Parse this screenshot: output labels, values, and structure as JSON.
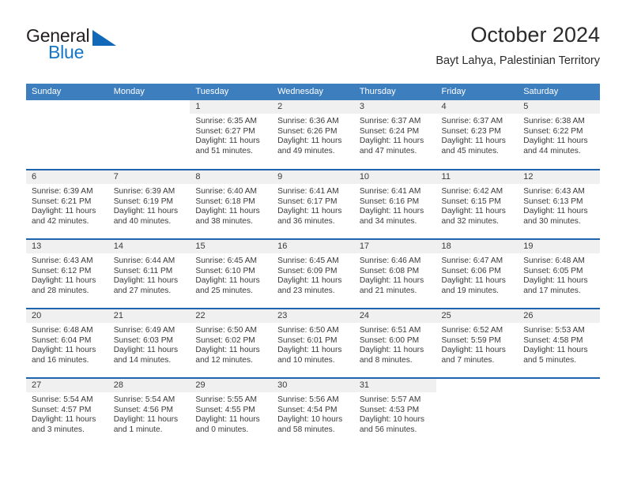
{
  "brand": {
    "name_part1": "General",
    "name_part2": "Blue",
    "triangle_color": "#1268b8",
    "blue_color": "#1476c6"
  },
  "header": {
    "title": "October 2024",
    "subtitle": "Bayt Lahya, Palestinian Territory"
  },
  "theme": {
    "header_row_bg": "#3d7ebf",
    "week_divider": "#1f64ad",
    "daynum_band_bg": "#f0f0f0",
    "text": "#3a3a3a"
  },
  "weekday_headers": [
    "Sunday",
    "Monday",
    "Tuesday",
    "Wednesday",
    "Thursday",
    "Friday",
    "Saturday"
  ],
  "weeks": [
    [
      {
        "day": "",
        "sunrise": "",
        "sunset": "",
        "daylight": ""
      },
      {
        "day": "",
        "sunrise": "",
        "sunset": "",
        "daylight": ""
      },
      {
        "day": "1",
        "sunrise": "Sunrise: 6:35 AM",
        "sunset": "Sunset: 6:27 PM",
        "daylight": "Daylight: 11 hours and 51 minutes."
      },
      {
        "day": "2",
        "sunrise": "Sunrise: 6:36 AM",
        "sunset": "Sunset: 6:26 PM",
        "daylight": "Daylight: 11 hours and 49 minutes."
      },
      {
        "day": "3",
        "sunrise": "Sunrise: 6:37 AM",
        "sunset": "Sunset: 6:24 PM",
        "daylight": "Daylight: 11 hours and 47 minutes."
      },
      {
        "day": "4",
        "sunrise": "Sunrise: 6:37 AM",
        "sunset": "Sunset: 6:23 PM",
        "daylight": "Daylight: 11 hours and 45 minutes."
      },
      {
        "day": "5",
        "sunrise": "Sunrise: 6:38 AM",
        "sunset": "Sunset: 6:22 PM",
        "daylight": "Daylight: 11 hours and 44 minutes."
      }
    ],
    [
      {
        "day": "6",
        "sunrise": "Sunrise: 6:39 AM",
        "sunset": "Sunset: 6:21 PM",
        "daylight": "Daylight: 11 hours and 42 minutes."
      },
      {
        "day": "7",
        "sunrise": "Sunrise: 6:39 AM",
        "sunset": "Sunset: 6:19 PM",
        "daylight": "Daylight: 11 hours and 40 minutes."
      },
      {
        "day": "8",
        "sunrise": "Sunrise: 6:40 AM",
        "sunset": "Sunset: 6:18 PM",
        "daylight": "Daylight: 11 hours and 38 minutes."
      },
      {
        "day": "9",
        "sunrise": "Sunrise: 6:41 AM",
        "sunset": "Sunset: 6:17 PM",
        "daylight": "Daylight: 11 hours and 36 minutes."
      },
      {
        "day": "10",
        "sunrise": "Sunrise: 6:41 AM",
        "sunset": "Sunset: 6:16 PM",
        "daylight": "Daylight: 11 hours and 34 minutes."
      },
      {
        "day": "11",
        "sunrise": "Sunrise: 6:42 AM",
        "sunset": "Sunset: 6:15 PM",
        "daylight": "Daylight: 11 hours and 32 minutes."
      },
      {
        "day": "12",
        "sunrise": "Sunrise: 6:43 AM",
        "sunset": "Sunset: 6:13 PM",
        "daylight": "Daylight: 11 hours and 30 minutes."
      }
    ],
    [
      {
        "day": "13",
        "sunrise": "Sunrise: 6:43 AM",
        "sunset": "Sunset: 6:12 PM",
        "daylight": "Daylight: 11 hours and 28 minutes."
      },
      {
        "day": "14",
        "sunrise": "Sunrise: 6:44 AM",
        "sunset": "Sunset: 6:11 PM",
        "daylight": "Daylight: 11 hours and 27 minutes."
      },
      {
        "day": "15",
        "sunrise": "Sunrise: 6:45 AM",
        "sunset": "Sunset: 6:10 PM",
        "daylight": "Daylight: 11 hours and 25 minutes."
      },
      {
        "day": "16",
        "sunrise": "Sunrise: 6:45 AM",
        "sunset": "Sunset: 6:09 PM",
        "daylight": "Daylight: 11 hours and 23 minutes."
      },
      {
        "day": "17",
        "sunrise": "Sunrise: 6:46 AM",
        "sunset": "Sunset: 6:08 PM",
        "daylight": "Daylight: 11 hours and 21 minutes."
      },
      {
        "day": "18",
        "sunrise": "Sunrise: 6:47 AM",
        "sunset": "Sunset: 6:06 PM",
        "daylight": "Daylight: 11 hours and 19 minutes."
      },
      {
        "day": "19",
        "sunrise": "Sunrise: 6:48 AM",
        "sunset": "Sunset: 6:05 PM",
        "daylight": "Daylight: 11 hours and 17 minutes."
      }
    ],
    [
      {
        "day": "20",
        "sunrise": "Sunrise: 6:48 AM",
        "sunset": "Sunset: 6:04 PM",
        "daylight": "Daylight: 11 hours and 16 minutes."
      },
      {
        "day": "21",
        "sunrise": "Sunrise: 6:49 AM",
        "sunset": "Sunset: 6:03 PM",
        "daylight": "Daylight: 11 hours and 14 minutes."
      },
      {
        "day": "22",
        "sunrise": "Sunrise: 6:50 AM",
        "sunset": "Sunset: 6:02 PM",
        "daylight": "Daylight: 11 hours and 12 minutes."
      },
      {
        "day": "23",
        "sunrise": "Sunrise: 6:50 AM",
        "sunset": "Sunset: 6:01 PM",
        "daylight": "Daylight: 11 hours and 10 minutes."
      },
      {
        "day": "24",
        "sunrise": "Sunrise: 6:51 AM",
        "sunset": "Sunset: 6:00 PM",
        "daylight": "Daylight: 11 hours and 8 minutes."
      },
      {
        "day": "25",
        "sunrise": "Sunrise: 6:52 AM",
        "sunset": "Sunset: 5:59 PM",
        "daylight": "Daylight: 11 hours and 7 minutes."
      },
      {
        "day": "26",
        "sunrise": "Sunrise: 5:53 AM",
        "sunset": "Sunset: 4:58 PM",
        "daylight": "Daylight: 11 hours and 5 minutes."
      }
    ],
    [
      {
        "day": "27",
        "sunrise": "Sunrise: 5:54 AM",
        "sunset": "Sunset: 4:57 PM",
        "daylight": "Daylight: 11 hours and 3 minutes."
      },
      {
        "day": "28",
        "sunrise": "Sunrise: 5:54 AM",
        "sunset": "Sunset: 4:56 PM",
        "daylight": "Daylight: 11 hours and 1 minute."
      },
      {
        "day": "29",
        "sunrise": "Sunrise: 5:55 AM",
        "sunset": "Sunset: 4:55 PM",
        "daylight": "Daylight: 11 hours and 0 minutes."
      },
      {
        "day": "30",
        "sunrise": "Sunrise: 5:56 AM",
        "sunset": "Sunset: 4:54 PM",
        "daylight": "Daylight: 10 hours and 58 minutes."
      },
      {
        "day": "31",
        "sunrise": "Sunrise: 5:57 AM",
        "sunset": "Sunset: 4:53 PM",
        "daylight": "Daylight: 10 hours and 56 minutes."
      },
      {
        "day": "",
        "sunrise": "",
        "sunset": "",
        "daylight": ""
      },
      {
        "day": "",
        "sunrise": "",
        "sunset": "",
        "daylight": ""
      }
    ]
  ]
}
